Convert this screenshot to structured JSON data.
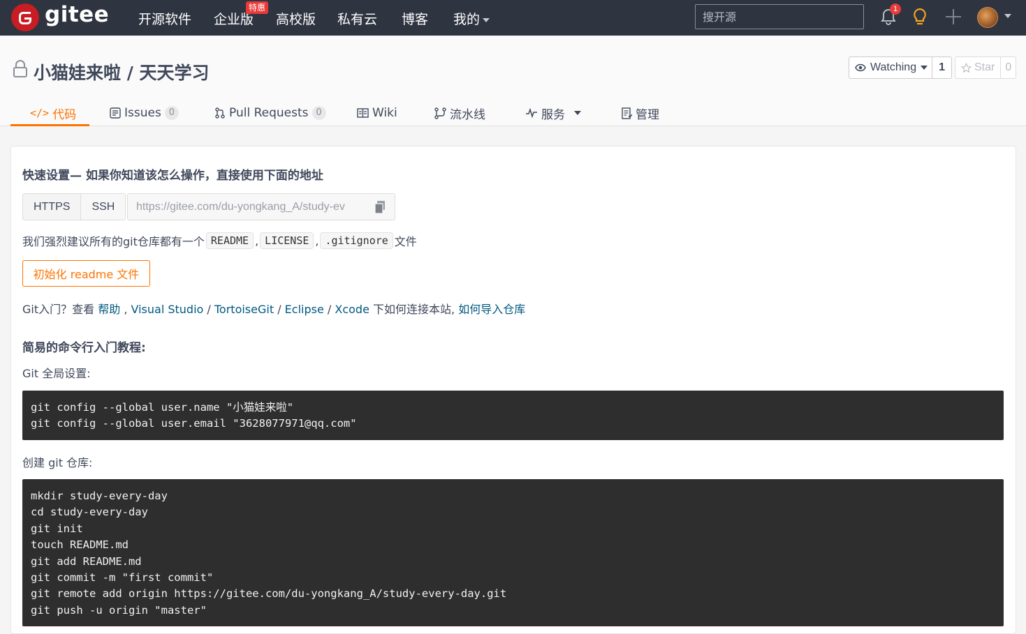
{
  "nav": {
    "logo_text": "gitee",
    "links": [
      "开源软件",
      "企业版",
      "高校版",
      "私有云",
      "博客",
      "我的"
    ],
    "promo_badge": "特惠",
    "search_placeholder": "搜开源",
    "notification_count": "1",
    "icons": [
      "bell-icon",
      "lightbulb-icon",
      "plus-icon",
      "avatar",
      "chevron-down-icon"
    ]
  },
  "repo": {
    "title": "小猫娃来啦 / 天天学习",
    "watch_label": "Watching",
    "watch_count": "1",
    "star_label": "Star",
    "star_count": "0"
  },
  "tabs": [
    {
      "label": "代码",
      "icon": "code-icon",
      "active": true
    },
    {
      "label": "Issues",
      "count": "0",
      "icon": "issues-icon"
    },
    {
      "label": "Pull Requests",
      "count": "0",
      "icon": "pull-request-icon"
    },
    {
      "label": "Wiki",
      "icon": "wiki-icon"
    },
    {
      "label": "流水线",
      "icon": "pipeline-icon"
    },
    {
      "label": "服务",
      "icon": "service-icon"
    },
    {
      "label": "管理",
      "icon": "manage-icon"
    }
  ],
  "quick_setup": {
    "heading": "快速设置— 如果你知道该怎么操作，直接使用下面的地址",
    "protocols": [
      "HTTPS",
      "SSH"
    ],
    "url": "https://gitee.com/du-yongkang_A/study-ev",
    "recommend_prefix": "我们强烈建议所有的git仓库都有一个",
    "recommend_files": [
      "README",
      "LICENSE",
      ".gitignore"
    ],
    "recommend_sep": ",",
    "recommend_suffix": "文件",
    "init_button": "初始化 readme 文件",
    "git_intro_prefix": "Git入门？查看",
    "git_intro_links": [
      "帮助",
      "Visual Studio",
      "TortoiseGit",
      "Eclipse",
      "Xcode"
    ],
    "git_intro_middle": "下如何连接本站,",
    "git_intro_import": "如何导入仓库"
  },
  "tutorial": {
    "heading": "简易的命令行入门教程:",
    "global_label": "Git 全局设置:",
    "global_commands": [
      "git config --global user.name \"小猫娃来啦\"",
      "git config --global user.email \"3628077971@qq.com\""
    ],
    "create_label": "创建 git 仓库:",
    "create_commands": [
      "mkdir study-every-day",
      "cd study-every-day",
      "git init",
      "touch README.md",
      "git add README.md",
      "git commit -m \"first commit\"",
      "git remote add origin https://gitee.com/du-yongkang_A/study-every-day.git",
      "git push -u origin \"master\""
    ]
  },
  "colors": {
    "nav_bg": "#2e3440",
    "accent": "#fe7300",
    "link": "#005980",
    "code_bg": "#2e2e2e",
    "brand_red": "#c71d23"
  }
}
